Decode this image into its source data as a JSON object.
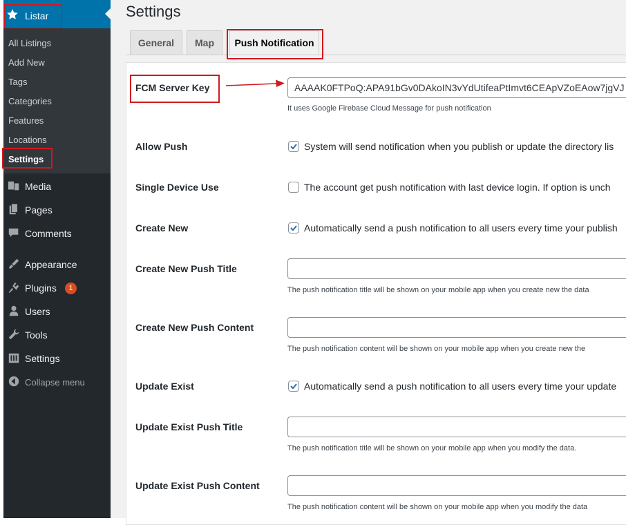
{
  "sidebar": {
    "top_item": {
      "label": "Listar",
      "icon": "star-icon"
    },
    "submenu": [
      {
        "label": "All Listings"
      },
      {
        "label": "Add New"
      },
      {
        "label": "Tags"
      },
      {
        "label": "Categories"
      },
      {
        "label": "Features"
      },
      {
        "label": "Locations"
      },
      {
        "label": "Settings",
        "current": true
      }
    ],
    "menu": [
      {
        "label": "Media",
        "icon": "media-icon"
      },
      {
        "label": "Pages",
        "icon": "pages-icon"
      },
      {
        "label": "Comments",
        "icon": "comments-icon"
      },
      {
        "label": "Appearance",
        "icon": "appearance-icon"
      },
      {
        "label": "Plugins",
        "icon": "plugins-icon",
        "badge": "1"
      },
      {
        "label": "Users",
        "icon": "users-icon"
      },
      {
        "label": "Tools",
        "icon": "tools-icon"
      },
      {
        "label": "Settings",
        "icon": "settings-icon"
      },
      {
        "label": "Collapse menu",
        "icon": "collapse-icon"
      }
    ]
  },
  "page": {
    "title": "Settings",
    "tabs": [
      {
        "label": "General"
      },
      {
        "label": "Map"
      },
      {
        "label": "Push Notification",
        "active": true
      }
    ]
  },
  "form": {
    "fcm_server_key": {
      "label": "FCM Server Key",
      "value": "AAAAK0FTPoQ:APA91bGv0DAkoIN3vYdUtifeaPtImvt6CEApVZoEAow7jgVJ",
      "description": "It uses Google Firebase Cloud Message for push notification"
    },
    "allow_push": {
      "label": "Allow Push",
      "checked": true,
      "text": "System will send notification when you publish or update the directory lis"
    },
    "single_device_use": {
      "label": "Single Device Use",
      "checked": false,
      "text": "The account get push notification with last device login. If option is unch"
    },
    "create_new": {
      "label": "Create New",
      "checked": true,
      "text": "Automatically send a push notification to all users every time your publish"
    },
    "create_new_push_title": {
      "label": "Create New Push Title",
      "value": "",
      "description": "The push notification title will be shown on your mobile app when you create new the data"
    },
    "create_new_push_content": {
      "label": "Create New Push Content",
      "value": "",
      "description": "The push notification content will be shown on your mobile app when you create new the"
    },
    "update_exist": {
      "label": "Update Exist",
      "checked": true,
      "text": "Automatically send a push notification to all users every time your update"
    },
    "update_exist_push_title": {
      "label": "Update Exist Push Title",
      "value": "",
      "description": "The push notification title will be shown on your mobile app when you modify the data."
    },
    "update_exist_push_content": {
      "label": "Update Exist Push Content",
      "value": "",
      "description": "The push notification content will be shown on your mobile app when you modify the data"
    }
  },
  "colors": {
    "sidebar_bg": "#23282d",
    "submenu_bg": "#32373c",
    "accent": "#0073aa",
    "highlight_box": "#d0191f",
    "checkbox_check": "#2271b1"
  }
}
